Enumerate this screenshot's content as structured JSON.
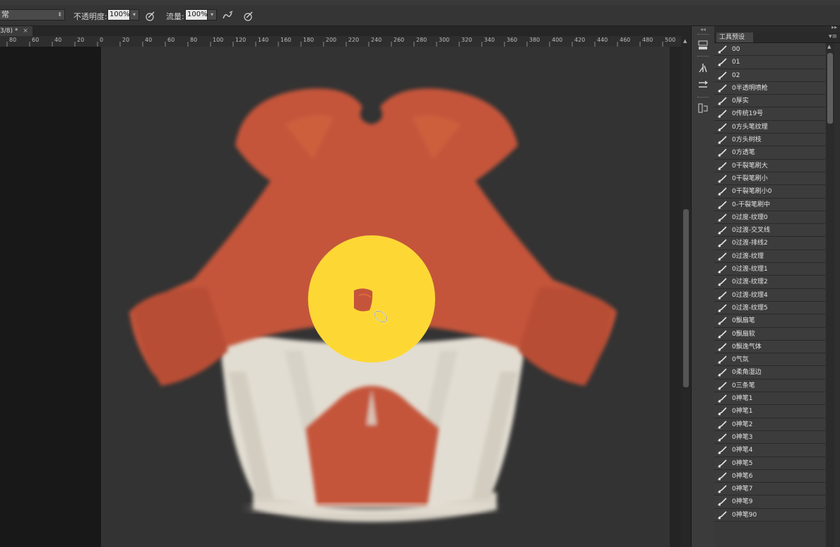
{
  "options_bar": {
    "blend_mode": "常",
    "opacity_label": "不透明度:",
    "opacity_value": "100%",
    "flow_label": "流量:",
    "flow_value": "100%"
  },
  "document": {
    "tab_label": "3/8) *",
    "close_glyph": "×"
  },
  "ruler": {
    "labels": [
      "80",
      "60",
      "40",
      "20",
      "0",
      "20",
      "40",
      "60",
      "80",
      "100",
      "120",
      "140",
      "160",
      "180",
      "200",
      "220",
      "240",
      "260",
      "280",
      "300",
      "320",
      "340",
      "360",
      "380",
      "400",
      "420",
      "440",
      "460",
      "480",
      "500"
    ]
  },
  "panel": {
    "tab_label": "工具预设",
    "items": [
      "00",
      "01",
      "02",
      "0半透明喷枪",
      "0厚实",
      "0传统19号",
      "0方头笔纹理",
      "0方头树枝",
      "0方透笔",
      "0干裂笔刷大",
      "0干裂笔刷小",
      "0干裂笔刷小0",
      "0-干裂笔刷中",
      "0过度-纹理0",
      "0过渡-交叉线",
      "0过渡-排线2",
      "0过渡-纹理",
      "0过渡-纹理1",
      "0过渡-纹理2",
      "0过渡-纹理4",
      "0过渡-纹理5",
      "0飘扇笔",
      "0飘扇软",
      "0飘逸气体",
      "0气氛",
      "0柔角湿边",
      "0三条笔",
      "0神笔1",
      "0神笔1",
      "0神笔2",
      "0神笔3",
      "0神笔4",
      "0神笔5",
      "0神笔6",
      "0神笔7",
      "0神笔9",
      "0神笔90"
    ]
  },
  "colors": {
    "paint_red": "#c4553a",
    "paint_cream": "#e2ddd2",
    "highlight_yellow": "#fdd835",
    "canvas_bg": "#333333"
  },
  "icons": {
    "brush_preset": "brush-icon",
    "airbrush": "airbrush-icon",
    "pressure": "pressure-pen-icon"
  }
}
